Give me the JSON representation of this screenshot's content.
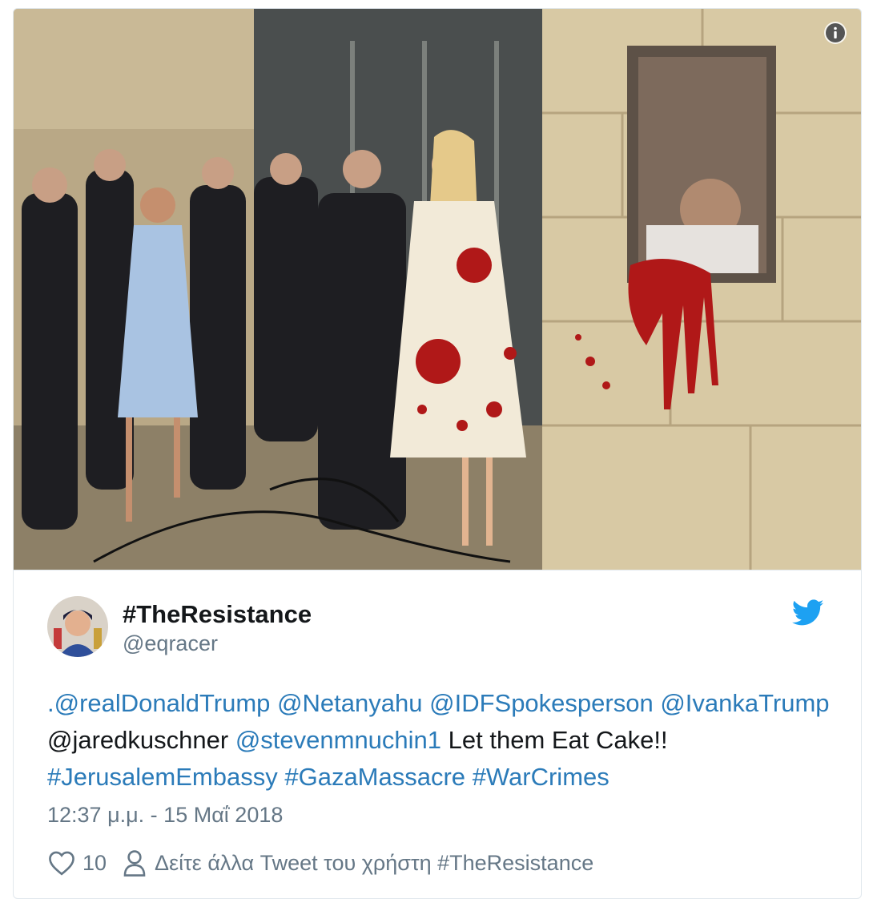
{
  "tweet": {
    "display_name": "#TheResistance",
    "handle": "@eqracer",
    "text_parts": {
      "p0": ".@realDonaldTrump",
      "p1": " ",
      "p2": "@Netanyahu",
      "p3": " ",
      "p4": "@IDFSpokesperson",
      "p5": " ",
      "p6": "@IvankaTrump",
      "p7": " @jaredkuschner ",
      "p8": "@stevenmnuchin1",
      "p9": " Let them Eat Cake!! ",
      "p10": "#JerusalemEmbassy",
      "p11": " ",
      "p12": "#GazaMassacre",
      "p13": " ",
      "p14": "#WarCrimes"
    },
    "timestamp": "12:37 μ.μ. - 15 Μαΐ 2018",
    "like_count": "10",
    "see_more": "Δείτε άλλα Tweet του χρήστη #TheResistance"
  },
  "icons": {
    "info": "info-icon",
    "twitter": "twitter-bird-icon",
    "heart": "heart-icon",
    "person": "person-icon"
  },
  "colors": {
    "link": "#2b7bb9",
    "twitter_blue": "#1da1f2",
    "text": "#14171a",
    "muted": "#657786",
    "border": "#e1e8ed"
  }
}
